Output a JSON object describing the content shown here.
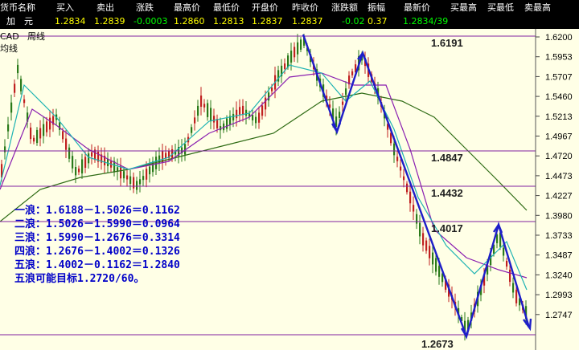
{
  "quote": {
    "headers": [
      "货币名称",
      "买入",
      "卖出",
      "涨跌",
      "最高价",
      "最低价",
      "开盘价",
      "昨收价",
      "涨跌额",
      "振幅",
      "最新价",
      "买最高",
      "买最低",
      "卖最高"
    ],
    "name": "加　元",
    "values": [
      "1.2834",
      "1.2839",
      "-0.0003",
      "1.2860",
      "1.2813",
      "1.2837",
      "1.2837",
      "-0.02",
      "0.37",
      "1.2834/39"
    ]
  },
  "chart": {
    "symbol": "CAD",
    "period": "周线",
    "ylabels": [
      "1.6200",
      "1.5953",
      "1.5707",
      "1.5460",
      "1.5213",
      "1.4967",
      "1.4720",
      "1.4473",
      "1.4227",
      "1.3980",
      "1.3733",
      "1.3487",
      "1.3240",
      "1.2993",
      "1.2747"
    ],
    "levels": [
      "1.6191",
      "1.4847",
      "1.4432",
      "1.4017",
      "1.2673"
    ]
  },
  "notes": [
    "一浪：1.6188－1.5026＝0.1162",
    "二浪：1.5026－1.5990＝0.0964",
    "三浪：1.5990－1.2676＝0.3314",
    "四浪：1.2676－1.4002＝0.1326",
    "五浪：1.4002－0.1162＝1.2840",
    "五浪可能目标1.2720/60。"
  ],
  "colors": {
    "bg": "#FFFFE6",
    "up": "#C02020",
    "down": "#2A7A1A",
    "wave": "#1E1EC8",
    "level": "#8020A0",
    "ma_long": "#2E6B14",
    "ma_mid": "#8A1FB0",
    "ma_short": "#1EB3B3"
  }
}
